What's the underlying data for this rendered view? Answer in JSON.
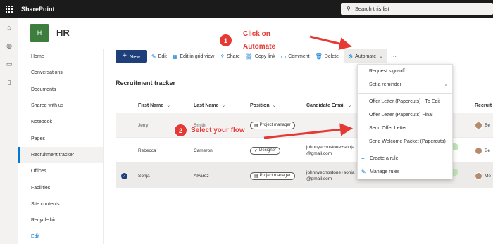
{
  "suite": {
    "brand": "SharePoint",
    "search_placeholder": "Search this list"
  },
  "site": {
    "logo_letter": "H",
    "title": "HR"
  },
  "nav": {
    "items": [
      {
        "label": "Home"
      },
      {
        "label": "Conversations"
      },
      {
        "label": "Documents"
      },
      {
        "label": "Shared with us"
      },
      {
        "label": "Notebook"
      },
      {
        "label": "Pages"
      },
      {
        "label": "Recruitment tracker",
        "active": true
      },
      {
        "label": "Offices"
      },
      {
        "label": "Facilities"
      },
      {
        "label": "Site contents"
      },
      {
        "label": "Recycle bin"
      }
    ],
    "edit": "Edit"
  },
  "commandbar": {
    "new": "New",
    "edit": "Edit",
    "grid": "Edit in grid view",
    "share": "Share",
    "copy": "Copy link",
    "comment": "Comment",
    "delete": "Delete",
    "automate": "Automate",
    "more": "···"
  },
  "automate_menu": {
    "items": [
      "Request sign-off",
      "Set a reminder",
      "Offer Letter (Papercuts) - To Edit",
      "Offer Letter (Papercuts) Final",
      "Send Offer Letter",
      "Send Welcome Packet (Papercuts)"
    ],
    "create_rule": "Create a rule",
    "manage_rules": "Manage rules"
  },
  "list": {
    "title": "Recruitment tracker",
    "columns": [
      "First Name",
      "Last Name",
      "Position",
      "Candidate Email",
      "Recruit"
    ],
    "rows": [
      {
        "first": "Jerry",
        "last": "Smith",
        "position": "Project manager",
        "email_1": "",
        "email_2": "",
        "person": "Be"
      },
      {
        "first": "Rebecca",
        "last": "Cameron",
        "position": "Designer",
        "email_1": "johnnyechostone+sonja",
        "email_2": "@gmail.com",
        "person": "Be"
      },
      {
        "first": "Sonja",
        "last": "Alvarez",
        "position": "Project manager",
        "email_1": "johnnyechostone+sonja",
        "email_2": "@gmail.com",
        "person": "Me"
      }
    ]
  },
  "annotations": {
    "step1_number": "1",
    "step1_line1": "Click on",
    "step1_line2": "Automate",
    "step2_number": "2",
    "step2_text": "Select your flow"
  },
  "colors": {
    "accent": "#0078d4",
    "new_button": "#1f3f7a",
    "annotation": "#e53935",
    "site_logo": "#3d7d3d"
  }
}
